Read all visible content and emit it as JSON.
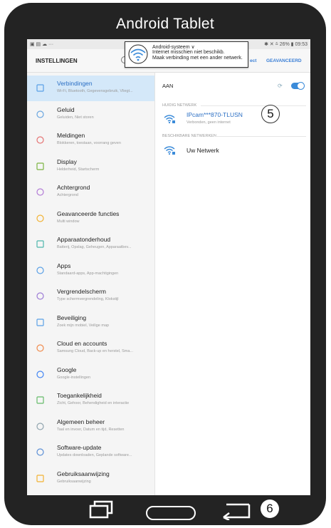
{
  "device": {
    "title": "Android Tablet"
  },
  "statusbar": {
    "left": "▣ ▤ ☁ ···",
    "right": "✱ ✕ ⩯ 26% ▮ 09:53"
  },
  "header": {
    "title": "INSTELLINGEN",
    "action_connect": "ect",
    "action_advanced": "GEAVANCEERD"
  },
  "notification": {
    "app": "Android-systeem ∨",
    "line1": "Internet misschien niet beschikb.",
    "line2": "Maak verbinding met een ander netwerk."
  },
  "menu": [
    {
      "title": "Verbindingen",
      "subtitle": "Wi-Fi, Bluetooth, Gegevensgebruik, Vliegt...",
      "icon": "connections-icon",
      "active": true
    },
    {
      "title": "Geluid",
      "subtitle": "Geluiden, Niet storen",
      "icon": "sound-icon"
    },
    {
      "title": "Meldingen",
      "subtitle": "Blokkeren, toestaan, voorrang geven",
      "icon": "notifications-icon"
    },
    {
      "title": "Display",
      "subtitle": "Helderheid, Startscherm",
      "icon": "display-icon"
    },
    {
      "title": "Achtergrond",
      "subtitle": "Achtergrond",
      "icon": "wallpaper-icon"
    },
    {
      "title": "Geavanceerde functies",
      "subtitle": "Multi window",
      "icon": "advanced-features-icon"
    },
    {
      "title": "Apparaatonderhoud",
      "subtitle": "Batterij, Opslag, Geheugen, Apparaatbev...",
      "icon": "device-maintenance-icon"
    },
    {
      "title": "Apps",
      "subtitle": "Standaard-apps, App-machtigingen",
      "icon": "apps-icon"
    },
    {
      "title": "Vergrendelscherm",
      "subtitle": "Type schermvergrendeling, Klokstijl",
      "icon": "lock-screen-icon"
    },
    {
      "title": "Beveiliging",
      "subtitle": "Zoek mijn mobiel, Veilige map",
      "icon": "security-icon"
    },
    {
      "title": "Cloud en accounts",
      "subtitle": "Samsung Cloud, Back-up en herstel, Sma...",
      "icon": "cloud-accounts-icon"
    },
    {
      "title": "Google",
      "subtitle": "Google-instellingen",
      "icon": "google-icon"
    },
    {
      "title": "Toegankelijkheid",
      "subtitle": "Zicht, Gehoor, Behendigheid en interactie",
      "icon": "accessibility-icon"
    },
    {
      "title": "Algemeen beheer",
      "subtitle": "Taal en invoer, Datum en tijd, Resetten",
      "icon": "general-management-icon"
    },
    {
      "title": "Software-update",
      "subtitle": "Updates downloaden, Geplande software...",
      "icon": "software-update-icon"
    },
    {
      "title": "Gebruiksaanwijzing",
      "subtitle": "Gebruiksaanwijzing",
      "icon": "user-manual-icon"
    }
  ],
  "wifi": {
    "toggle_label": "AAN",
    "toggle_on": true,
    "current_section": "HUIDIG NETWERK",
    "current_network": {
      "name": "IPcam***870-TLUSN",
      "status": "Verbonden, geen internet"
    },
    "available_section": "BESCHIKBARE NETWERKEN",
    "available_networks": [
      {
        "name": "Uw Netwerk"
      }
    ]
  },
  "markers": {
    "five": "5",
    "six": "6"
  },
  "colors": {
    "accent": "#3b8bd9",
    "active_bg": "#d4e8f9",
    "bezel": "#232323"
  }
}
